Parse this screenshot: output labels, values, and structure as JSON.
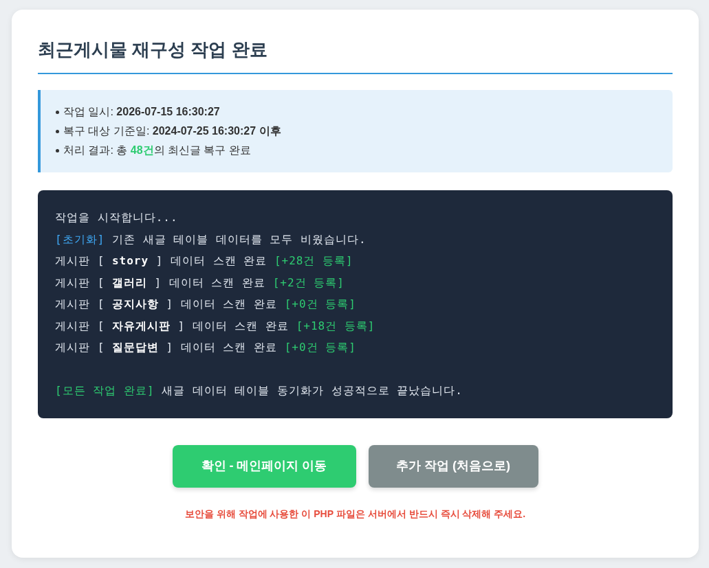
{
  "title": "최근게시물 재구성 작업 완료",
  "summary": [
    {
      "segments": [
        {
          "kind": "plain",
          "text": "작업 일시: "
        },
        {
          "kind": "strong",
          "text": "2026-07-15 16:30:27"
        }
      ]
    },
    {
      "segments": [
        {
          "kind": "plain",
          "text": "복구 대상 기준일: "
        },
        {
          "kind": "strong",
          "text": "2024-07-25 16:30:27 이후"
        }
      ]
    },
    {
      "segments": [
        {
          "kind": "plain",
          "text": "처리 결과: 총 "
        },
        {
          "kind": "highlight",
          "text": "48건"
        },
        {
          "kind": "plain",
          "text": "의 최신글 복구 완료"
        }
      ]
    }
  ],
  "log": {
    "paragraphs": [
      [
        {
          "segments": [
            {
              "kind": "plain",
              "text": "작업을 시작합니다..."
            }
          ]
        },
        {
          "segments": [
            {
              "kind": "tag_info",
              "text": "[초기화]"
            },
            {
              "kind": "plain",
              "text": " 기존 새글 테이블 데이터를 모두 비웠습니다."
            }
          ]
        },
        {
          "segments": [
            {
              "kind": "plain",
              "text": "게시판 [ "
            },
            {
              "kind": "board",
              "text": "story"
            },
            {
              "kind": "plain",
              "text": " ] 데이터 스캔 완료 "
            },
            {
              "kind": "count",
              "text": "[+28건 등록]"
            }
          ]
        },
        {
          "segments": [
            {
              "kind": "plain",
              "text": "게시판 [ "
            },
            {
              "kind": "board",
              "text": "갤러리"
            },
            {
              "kind": "plain",
              "text": " ] 데이터 스캔 완료 "
            },
            {
              "kind": "count",
              "text": "[+2건 등록]"
            }
          ]
        },
        {
          "segments": [
            {
              "kind": "plain",
              "text": "게시판 [ "
            },
            {
              "kind": "board",
              "text": "공지사항"
            },
            {
              "kind": "plain",
              "text": " ] 데이터 스캔 완료 "
            },
            {
              "kind": "count",
              "text": "[+0건 등록]"
            }
          ]
        },
        {
          "segments": [
            {
              "kind": "plain",
              "text": "게시판 [ "
            },
            {
              "kind": "board",
              "text": "자유게시판"
            },
            {
              "kind": "plain",
              "text": " ] 데이터 스캔 완료 "
            },
            {
              "kind": "count",
              "text": "[+18건 등록]"
            }
          ]
        },
        {
          "segments": [
            {
              "kind": "plain",
              "text": "게시판 [ "
            },
            {
              "kind": "board",
              "text": "질문답변"
            },
            {
              "kind": "plain",
              "text": " ] 데이터 스캔 완료 "
            },
            {
              "kind": "count",
              "text": "[+0건 등록]"
            }
          ]
        }
      ],
      [
        {
          "segments": [
            {
              "kind": "tag_success",
              "text": "[모든 작업 완료]"
            },
            {
              "kind": "plain",
              "text": " 새글 데이터 테이블 동기화가 성공적으로 끝났습니다."
            }
          ]
        }
      ]
    ]
  },
  "buttons": [
    {
      "kind": "primary",
      "label": "확인 - 메인페이지 이동"
    },
    {
      "kind": "secondary",
      "label": "추가 작업 (처음으로)"
    }
  ],
  "warning": "보안을 위해 작업에 사용한 이 **PHP** 파일은 서버에서 반드시 즉시 삭제해 주세요."
}
